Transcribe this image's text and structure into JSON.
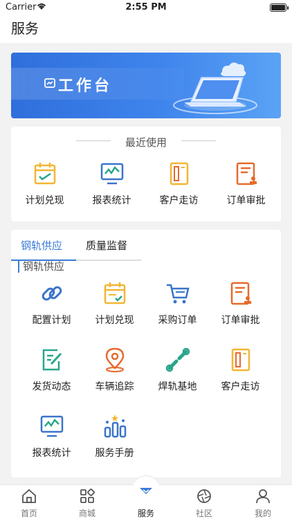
{
  "status": {
    "carrier": "Carrier",
    "time": "2:55 PM"
  },
  "header": {
    "title": "服务"
  },
  "banner": {
    "title": "工作台"
  },
  "recent": {
    "title": "最近使用",
    "items": [
      {
        "label": "计划兑现",
        "icon": "calendar-check-icon"
      },
      {
        "label": "报表统计",
        "icon": "chart-monitor-icon"
      },
      {
        "label": "客户走访",
        "icon": "client-visit-icon"
      },
      {
        "label": "订单审批",
        "icon": "order-approve-icon"
      }
    ]
  },
  "supply": {
    "tabs": [
      {
        "label": "钢轨供应"
      },
      {
        "label": "质量监督"
      }
    ],
    "section_title": "钢轨供应",
    "items": [
      {
        "label": "配置计划",
        "icon": "link-icon"
      },
      {
        "label": "计划兑现",
        "icon": "calendar-check-icon"
      },
      {
        "label": "采购订单",
        "icon": "cart-icon"
      },
      {
        "label": "订单审批",
        "icon": "order-approve-icon"
      },
      {
        "label": "发货动态",
        "icon": "edit-doc-icon"
      },
      {
        "label": "车辆追踪",
        "icon": "location-pin-icon"
      },
      {
        "label": "焊轨基地",
        "icon": "wrench-icon"
      },
      {
        "label": "客户走访",
        "icon": "client-visit-icon"
      },
      {
        "label": "报表统计",
        "icon": "chart-monitor-icon"
      },
      {
        "label": "服务手册",
        "icon": "manual-icon"
      }
    ]
  },
  "tabbar": {
    "items": [
      {
        "label": "首页",
        "icon": "home-icon"
      },
      {
        "label": "商城",
        "icon": "grid-icon"
      },
      {
        "label": "服务",
        "icon": "service-icon"
      },
      {
        "label": "社区",
        "icon": "aperture-icon"
      },
      {
        "label": "我的",
        "icon": "user-icon"
      }
    ],
    "active_index": 2
  },
  "colors": {
    "accent": "#3a7bd5",
    "orange": "#e66a2c",
    "yellow": "#f2b632",
    "green": "#2aa58a",
    "blue": "#3a74c9"
  }
}
